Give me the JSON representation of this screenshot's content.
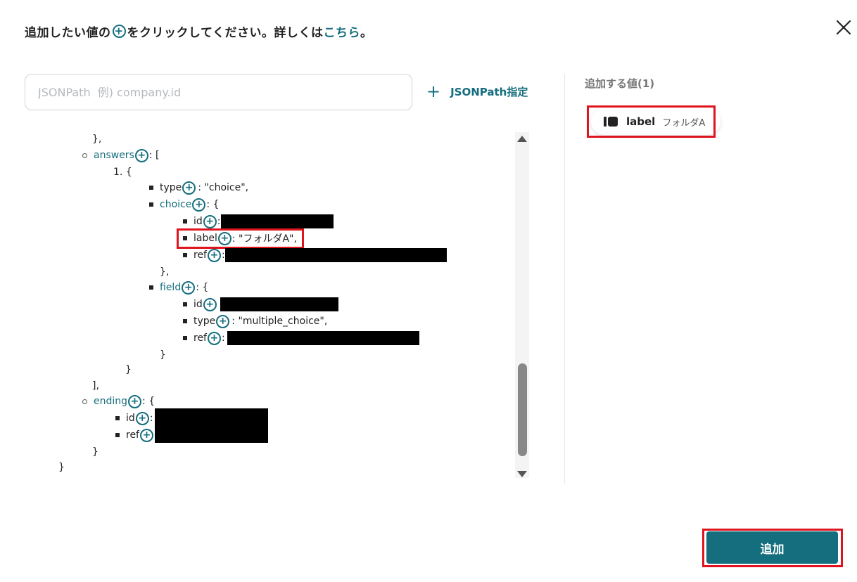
{
  "instruction": {
    "prefix": "追加したい値の",
    "plus_glyph": "+",
    "middle": "をクリックしてください。詳しくは",
    "link": "こちら",
    "suffix": "。"
  },
  "search": {
    "placeholder": "JSONPath  例) company.id",
    "value": ""
  },
  "jsonpath_button": {
    "icon": "+",
    "label": "JSONPath指定"
  },
  "tree": {
    "plus": "+",
    "close_obj_comma": "},",
    "answers_key": "answers",
    "open_arr": ": [",
    "item_1": "1. {",
    "type_key": "type",
    "type_val": ": \"choice\",",
    "choice_key": "choice",
    "open_obj": ": {",
    "id_key": "id",
    "colon": ":",
    "label_key": "label",
    "label_val": ": \"フォルダA\",",
    "ref_key": "ref",
    "close_obj_comma2": "},",
    "field_key": "field",
    "field_type_val": ": \"multiple_choice\",",
    "close_obj": "}",
    "close_item": "}",
    "close_arr": "],",
    "ending_key": "ending",
    "close_ending": "}",
    "close_root": "}"
  },
  "added_panel": {
    "heading": "追加する値(1)",
    "items": [
      {
        "label": "label",
        "value": "フォルダA"
      }
    ]
  },
  "add_button": {
    "label": "追加"
  },
  "colors": {
    "accent": "#146e7e",
    "highlight": "#e0141e"
  }
}
